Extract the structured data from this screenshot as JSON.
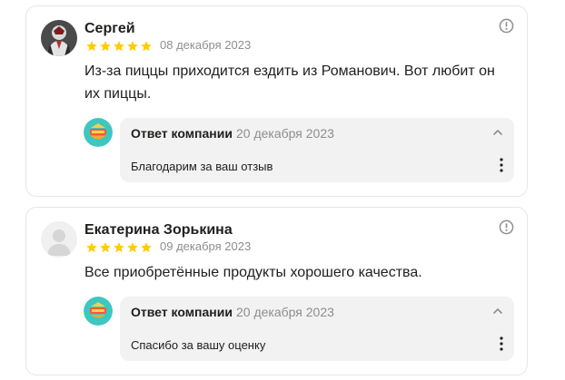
{
  "reviews": [
    {
      "author": "Сергей",
      "rating": 5,
      "date": "08 декабря 2023",
      "text": "Из-за пиццы приходится ездить из Романович. Вот любит он их пиццы.",
      "answer": {
        "title": "Ответ компании",
        "date": "20 декабря 2023",
        "text": "Благодарим за ваш отзыв"
      }
    },
    {
      "author": "Екатерина Зорькина",
      "rating": 5,
      "date": "09 декабря 2023",
      "text": "Все приобретённые продукты хорошего качества.",
      "answer": {
        "title": "Ответ компании",
        "date": "20 декабря 2023",
        "text": "Спасибо за вашу оценку"
      }
    }
  ],
  "colors": {
    "star": "#fc0",
    "muted_text": "#8e8e8e",
    "answer_bg": "#f2f2f2",
    "card_border": "#e6e6e6",
    "logo_bg": "#3ec6c0"
  },
  "icons": {
    "report": "exclamation-circle-icon",
    "collapse": "chevron-up-icon",
    "more": "vertical-dots-icon",
    "star": "star-icon"
  }
}
